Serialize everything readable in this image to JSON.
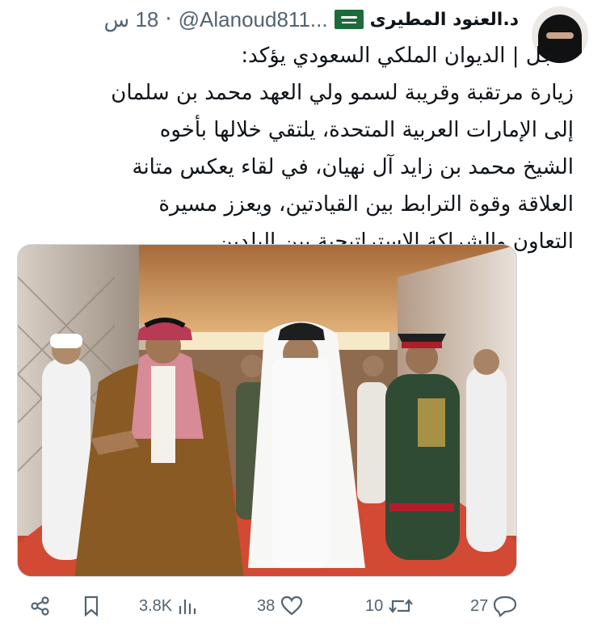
{
  "author": {
    "name": "د.العنود المطيرى",
    "handle": "@Alanoud811...",
    "separator": "·",
    "time": "18 س"
  },
  "tweet": {
    "lines": [
      "عاجل | الديوان الملكي السعودي يؤكد:",
      "زيارة مرتقبة وقريبة لسمو ولي العهد محمد بن سلمان",
      "إلى الإمارات العربية المتحدة، يلتقي خلالها بأخوه",
      "الشيخ محمد بن زايد آل نهيان، في لقاء يعكس متانة",
      "العلاقة وقوة الترابط بين القيادتين، ويعزز مسيرة",
      "التعاون والشراكة الاستراتيجية بين البلدين."
    ]
  },
  "actions": {
    "views": "3.8K",
    "likes": "38",
    "retweets": "10",
    "replies": "27"
  },
  "icons": {
    "share": "share-icon",
    "bookmark": "bookmark-icon",
    "views": "views-icon",
    "like": "heart-icon",
    "retweet": "retweet-icon",
    "reply": "reply-icon"
  },
  "colors": {
    "text": "#0f1419",
    "muted": "#536471",
    "flag": "#1e6b3a"
  }
}
